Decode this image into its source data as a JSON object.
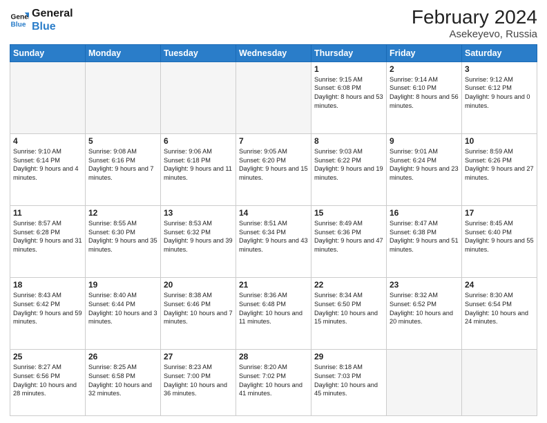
{
  "header": {
    "logo_line1": "General",
    "logo_line2": "Blue",
    "month_year": "February 2024",
    "location": "Asekeyevo, Russia"
  },
  "days_of_week": [
    "Sunday",
    "Monday",
    "Tuesday",
    "Wednesday",
    "Thursday",
    "Friday",
    "Saturday"
  ],
  "weeks": [
    [
      {
        "day": "",
        "info": ""
      },
      {
        "day": "",
        "info": ""
      },
      {
        "day": "",
        "info": ""
      },
      {
        "day": "",
        "info": ""
      },
      {
        "day": "1",
        "info": "Sunrise: 9:15 AM\nSunset: 6:08 PM\nDaylight: 8 hours\nand 53 minutes."
      },
      {
        "day": "2",
        "info": "Sunrise: 9:14 AM\nSunset: 6:10 PM\nDaylight: 8 hours\nand 56 minutes."
      },
      {
        "day": "3",
        "info": "Sunrise: 9:12 AM\nSunset: 6:12 PM\nDaylight: 9 hours\nand 0 minutes."
      }
    ],
    [
      {
        "day": "4",
        "info": "Sunrise: 9:10 AM\nSunset: 6:14 PM\nDaylight: 9 hours\nand 4 minutes."
      },
      {
        "day": "5",
        "info": "Sunrise: 9:08 AM\nSunset: 6:16 PM\nDaylight: 9 hours\nand 7 minutes."
      },
      {
        "day": "6",
        "info": "Sunrise: 9:06 AM\nSunset: 6:18 PM\nDaylight: 9 hours\nand 11 minutes."
      },
      {
        "day": "7",
        "info": "Sunrise: 9:05 AM\nSunset: 6:20 PM\nDaylight: 9 hours\nand 15 minutes."
      },
      {
        "day": "8",
        "info": "Sunrise: 9:03 AM\nSunset: 6:22 PM\nDaylight: 9 hours\nand 19 minutes."
      },
      {
        "day": "9",
        "info": "Sunrise: 9:01 AM\nSunset: 6:24 PM\nDaylight: 9 hours\nand 23 minutes."
      },
      {
        "day": "10",
        "info": "Sunrise: 8:59 AM\nSunset: 6:26 PM\nDaylight: 9 hours\nand 27 minutes."
      }
    ],
    [
      {
        "day": "11",
        "info": "Sunrise: 8:57 AM\nSunset: 6:28 PM\nDaylight: 9 hours\nand 31 minutes."
      },
      {
        "day": "12",
        "info": "Sunrise: 8:55 AM\nSunset: 6:30 PM\nDaylight: 9 hours\nand 35 minutes."
      },
      {
        "day": "13",
        "info": "Sunrise: 8:53 AM\nSunset: 6:32 PM\nDaylight: 9 hours\nand 39 minutes."
      },
      {
        "day": "14",
        "info": "Sunrise: 8:51 AM\nSunset: 6:34 PM\nDaylight: 9 hours\nand 43 minutes."
      },
      {
        "day": "15",
        "info": "Sunrise: 8:49 AM\nSunset: 6:36 PM\nDaylight: 9 hours\nand 47 minutes."
      },
      {
        "day": "16",
        "info": "Sunrise: 8:47 AM\nSunset: 6:38 PM\nDaylight: 9 hours\nand 51 minutes."
      },
      {
        "day": "17",
        "info": "Sunrise: 8:45 AM\nSunset: 6:40 PM\nDaylight: 9 hours\nand 55 minutes."
      }
    ],
    [
      {
        "day": "18",
        "info": "Sunrise: 8:43 AM\nSunset: 6:42 PM\nDaylight: 9 hours\nand 59 minutes."
      },
      {
        "day": "19",
        "info": "Sunrise: 8:40 AM\nSunset: 6:44 PM\nDaylight: 10 hours\nand 3 minutes."
      },
      {
        "day": "20",
        "info": "Sunrise: 8:38 AM\nSunset: 6:46 PM\nDaylight: 10 hours\nand 7 minutes."
      },
      {
        "day": "21",
        "info": "Sunrise: 8:36 AM\nSunset: 6:48 PM\nDaylight: 10 hours\nand 11 minutes."
      },
      {
        "day": "22",
        "info": "Sunrise: 8:34 AM\nSunset: 6:50 PM\nDaylight: 10 hours\nand 15 minutes."
      },
      {
        "day": "23",
        "info": "Sunrise: 8:32 AM\nSunset: 6:52 PM\nDaylight: 10 hours\nand 20 minutes."
      },
      {
        "day": "24",
        "info": "Sunrise: 8:30 AM\nSunset: 6:54 PM\nDaylight: 10 hours\nand 24 minutes."
      }
    ],
    [
      {
        "day": "25",
        "info": "Sunrise: 8:27 AM\nSunset: 6:56 PM\nDaylight: 10 hours\nand 28 minutes."
      },
      {
        "day": "26",
        "info": "Sunrise: 8:25 AM\nSunset: 6:58 PM\nDaylight: 10 hours\nand 32 minutes."
      },
      {
        "day": "27",
        "info": "Sunrise: 8:23 AM\nSunset: 7:00 PM\nDaylight: 10 hours\nand 36 minutes."
      },
      {
        "day": "28",
        "info": "Sunrise: 8:20 AM\nSunset: 7:02 PM\nDaylight: 10 hours\nand 41 minutes."
      },
      {
        "day": "29",
        "info": "Sunrise: 8:18 AM\nSunset: 7:03 PM\nDaylight: 10 hours\nand 45 minutes."
      },
      {
        "day": "",
        "info": ""
      },
      {
        "day": "",
        "info": ""
      }
    ]
  ]
}
